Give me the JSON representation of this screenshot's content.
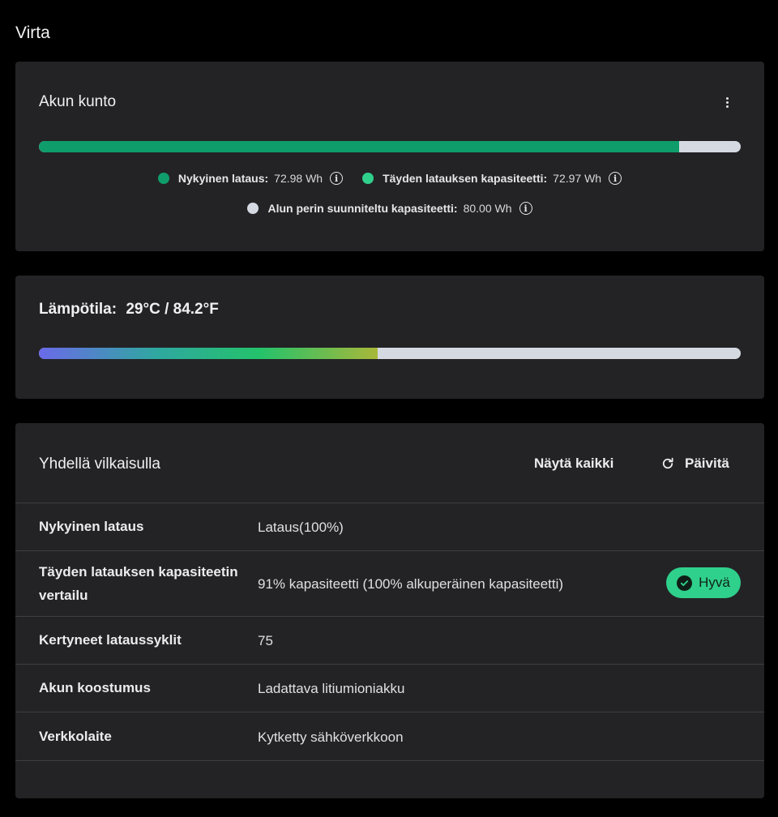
{
  "page": {
    "title": "Virta"
  },
  "battery_health": {
    "title": "Akun kunto",
    "charge_fraction": 0.9121,
    "legend": [
      {
        "label": "Nykyinen lataus:",
        "value": "72.98 Wh",
        "color": "#0f9d6b"
      },
      {
        "label": "Täyden latauksen kapasiteetti:",
        "value": "72.97 Wh",
        "color": "#2fd08c"
      },
      {
        "label": "Alun perin suunniteltu kapasiteetti:",
        "value": "80.00 Wh",
        "color": "#d5d9e2"
      }
    ]
  },
  "temperature": {
    "label": "Lämpötila:",
    "value": "29°C / 84.2°F",
    "level_fraction": 0.483
  },
  "glance": {
    "title": "Yhdellä vilkaisulla",
    "show_all_label": "Näytä kaikki",
    "refresh_label": "Päivitä",
    "rows": [
      {
        "label": "Nykyinen lataus",
        "value": "Lataus(100%)"
      },
      {
        "label_line1": "Täyden latauksen kapasiteetin",
        "label_line2": "vertailu",
        "value": "91% kapasiteetti (100% alkuperäinen kapasiteetti)",
        "badge": "Hyvä"
      },
      {
        "label": "Kertyneet lataussyklit",
        "value": "75"
      },
      {
        "label": "Akun koostumus",
        "value": "Ladattava litiumioniakku"
      },
      {
        "label": "Verkkolaite",
        "value": "Kytketty sähköverkkoon"
      }
    ]
  },
  "colors": {
    "background": "#000000",
    "card": "#232326",
    "charge_green": "#0f9d6b",
    "full_capacity_green": "#2fd08c",
    "bar_track": "#d5d9e2",
    "badge_green": "#2fd08c"
  }
}
